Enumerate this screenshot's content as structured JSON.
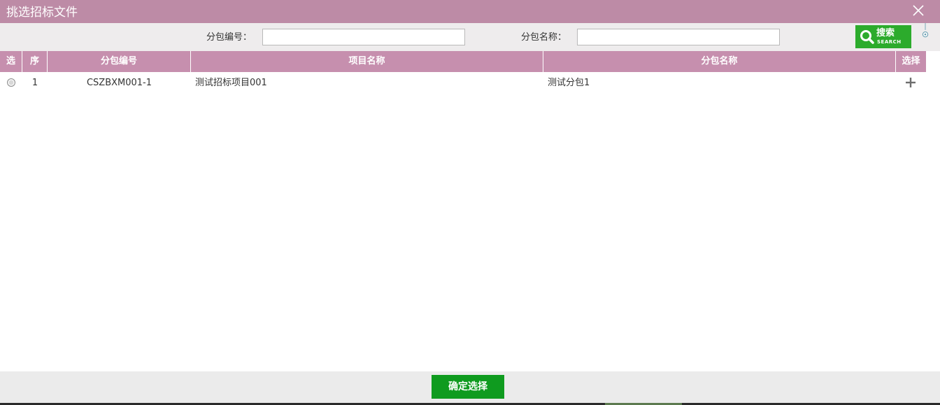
{
  "window": {
    "title": "挑选招标文件",
    "close_icon": "close-icon",
    "title_bar_color": "#bd8ba6"
  },
  "search": {
    "package_code_label": "分包编号：",
    "package_code_value": "",
    "package_name_label": "分包名称：",
    "package_name_value": "",
    "button_label": "搜索",
    "button_sublabel": "SEARCH",
    "button_color": "#2cab2c"
  },
  "table": {
    "header_color": "#c68fae",
    "columns": [
      "选",
      "序",
      "分包编号",
      "项目名称",
      "分包名称",
      "选择"
    ],
    "rows": [
      {
        "index": "1",
        "package_code": "CSZBXM001-1",
        "project_name": "测试招标项目001",
        "package_name": "测试分包1",
        "select_icon": "plus-icon"
      }
    ]
  },
  "footer": {
    "confirm_label": "确定选择",
    "confirm_color": "#0f9b1f"
  }
}
